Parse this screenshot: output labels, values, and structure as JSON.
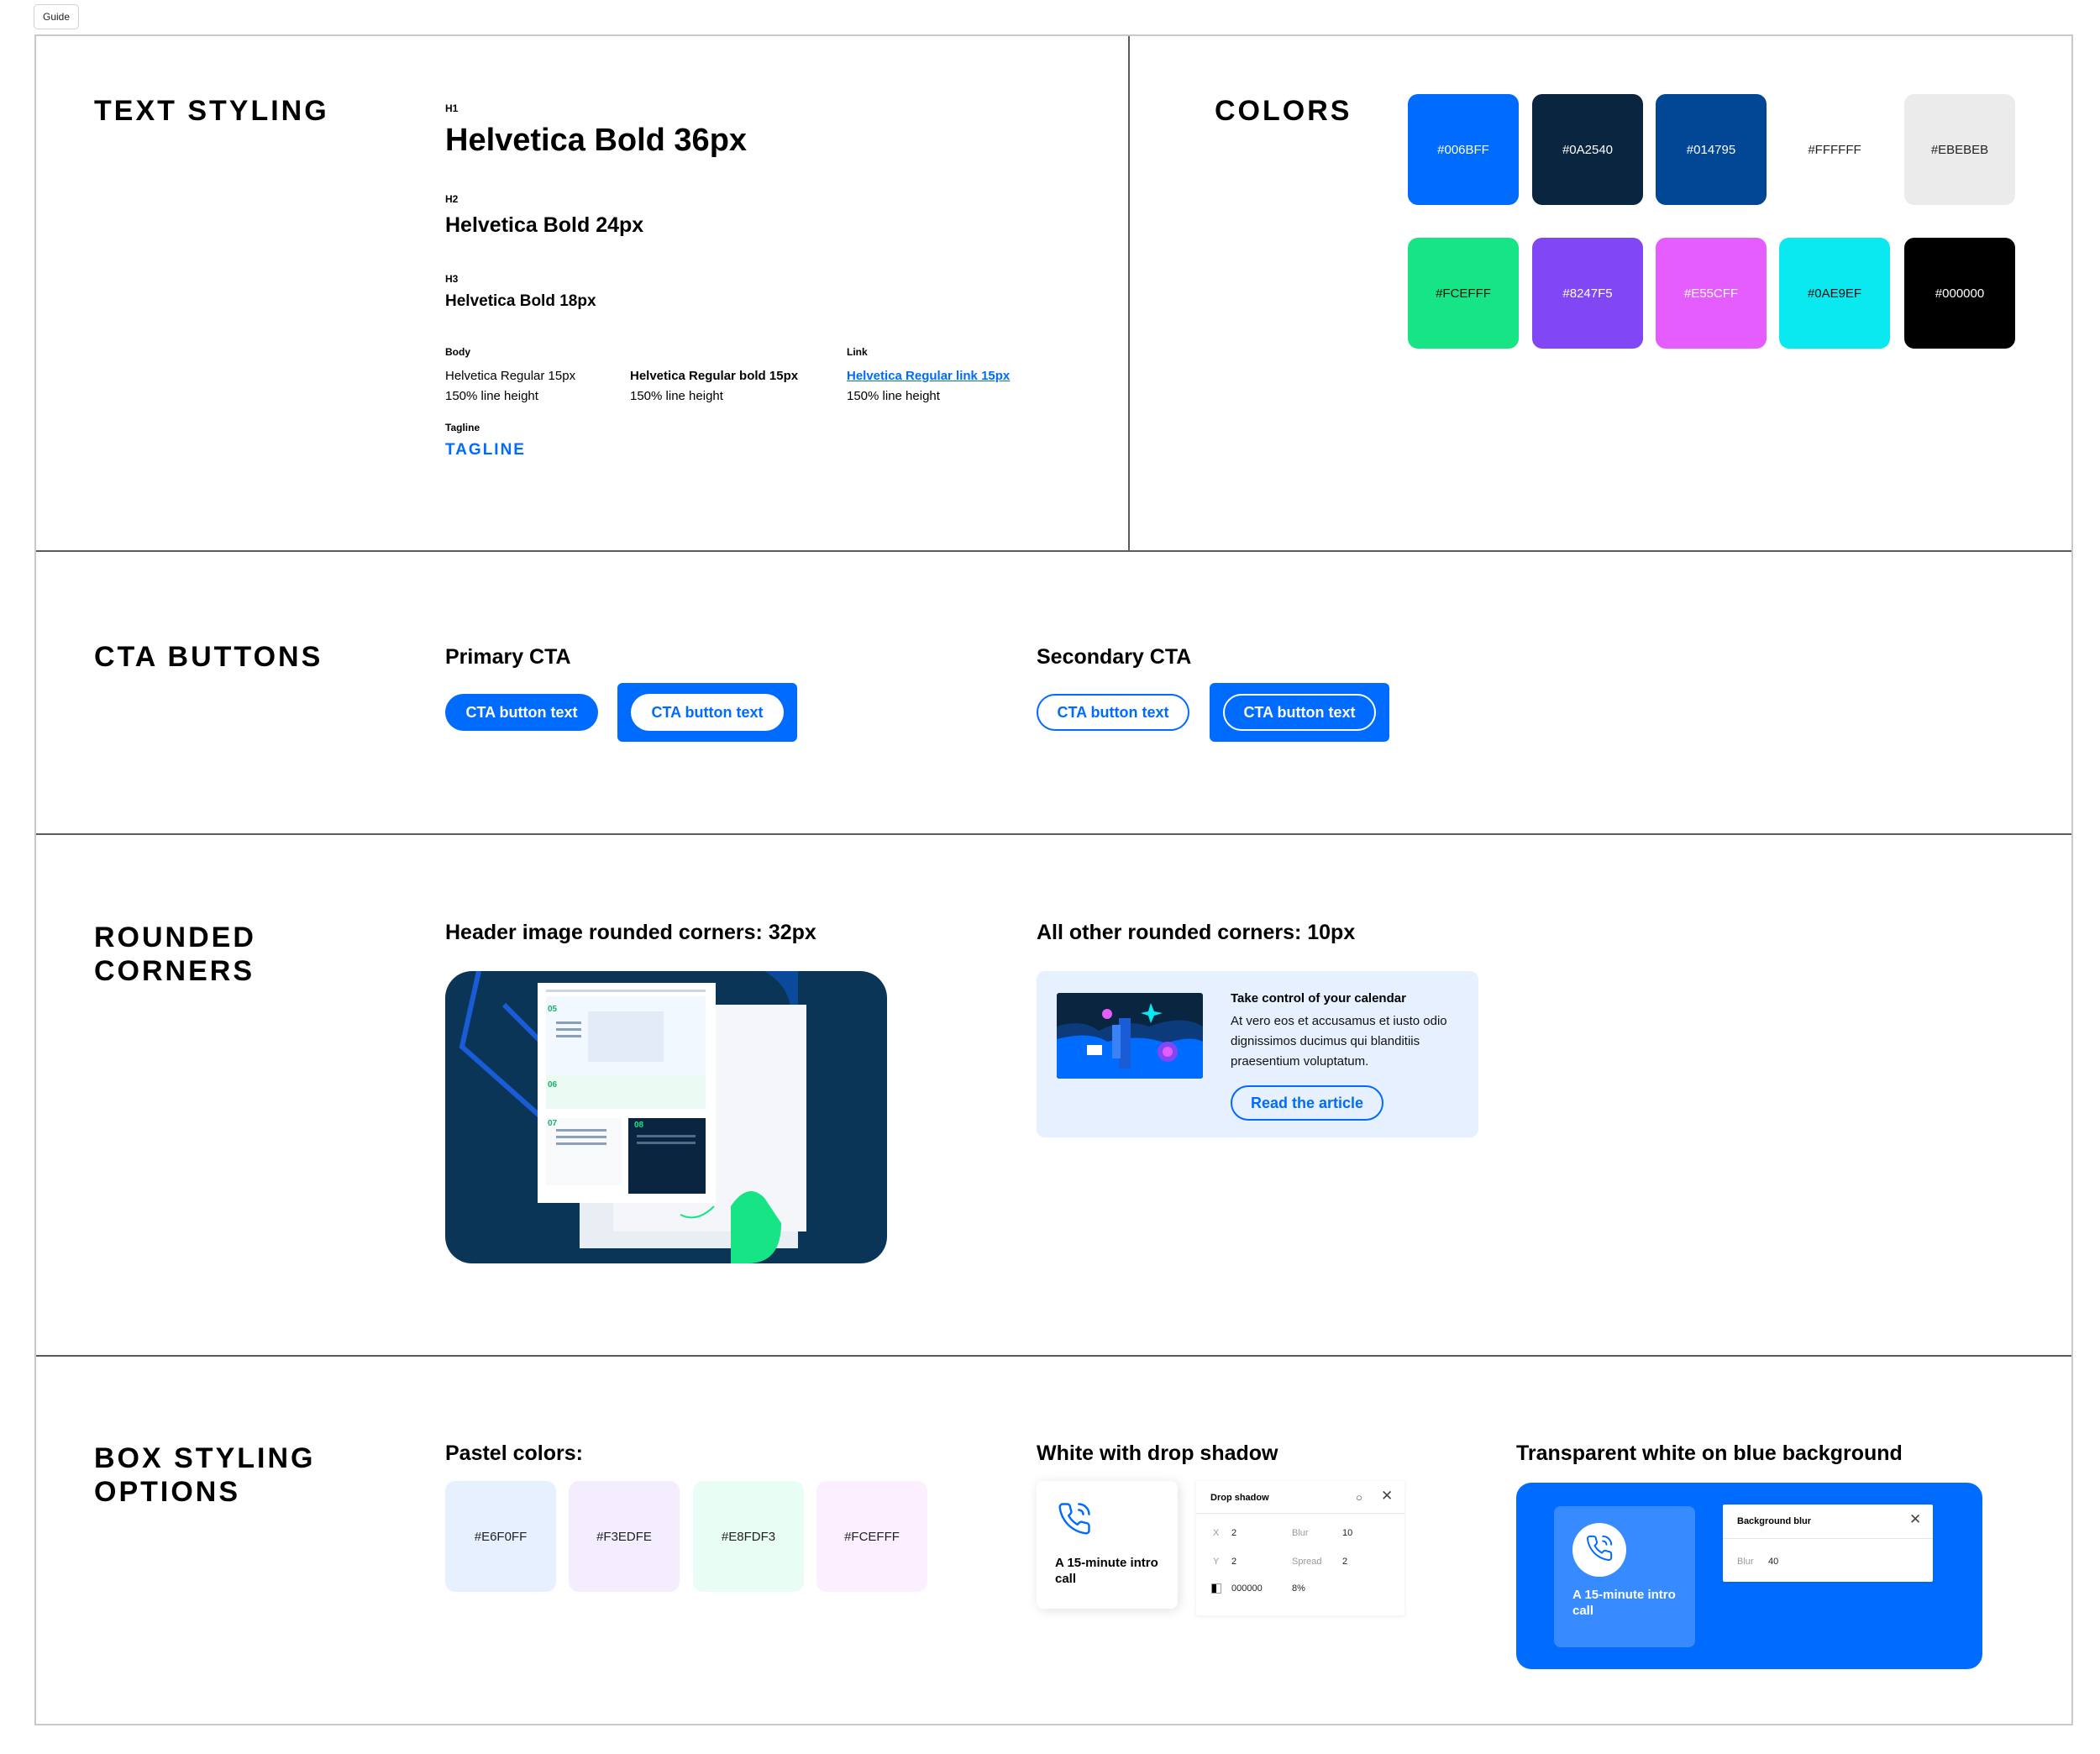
{
  "guide_tab": "Guide",
  "text_styling": {
    "title": "TEXT STYLING",
    "h1_label": "H1",
    "h1_sample": "Helvetica Bold 36px",
    "h2_label": "H2",
    "h2_sample": "Helvetica Bold 24px",
    "h3_label": "H3",
    "h3_sample": "Helvetica Bold 18px",
    "body_label": "Body",
    "body_regular": "Helvetica Regular 15px",
    "body_regular_lh": "150% line height",
    "body_bold": "Helvetica Regular bold 15px",
    "body_bold_lh": "150% line height",
    "link_label": "Link",
    "link_sample": "Helvetica Regular link 15px",
    "link_lh": "150% line height",
    "tagline_label": "Tagline",
    "tagline_sample": "TAGLINE"
  },
  "colors": {
    "title": "COLORS",
    "swatches": [
      {
        "label": "#006BFF",
        "bg": "#006BFF",
        "fg": "#ffffff"
      },
      {
        "label": "#0A2540",
        "bg": "#0A2540",
        "fg": "#ffffff"
      },
      {
        "label": "#014795",
        "bg": "#014795",
        "fg": "#ffffff"
      },
      {
        "label": "#FFFFFF",
        "bg": "#FFFFFF",
        "fg": "#222222"
      },
      {
        "label": "#EBEBEB",
        "bg": "#EBEBEB",
        "fg": "#222222"
      },
      {
        "label": "#FCEFFF",
        "bg": "#17E585",
        "fg": "#111111"
      },
      {
        "label": "#8247F5",
        "bg": "#8247F5",
        "fg": "#ffffff"
      },
      {
        "label": "#E55CFF",
        "bg": "#E55CFF",
        "fg": "#ffffff"
      },
      {
        "label": "#0AE9EF",
        "bg": "#0AE9EF",
        "fg": "#111111"
      },
      {
        "label": "#000000",
        "bg": "#000000",
        "fg": "#ffffff"
      }
    ]
  },
  "cta": {
    "title": "CTA BUTTONS",
    "primary_title": "Primary CTA",
    "secondary_title": "Secondary CTA",
    "button_text": "CTA button text"
  },
  "rounded": {
    "title": "ROUNDED CORNERS",
    "header_title": "Header image rounded corners: 32px",
    "other_title": "All other rounded corners: 10px",
    "article_title": "Take control of your calendar",
    "article_text": "At vero eos et accusamus et iusto odio dignissimos ducimus qui blanditiis praesentium voluptatum.",
    "article_button": "Read the article",
    "doc_numbers": [
      "05",
      "06",
      "07",
      "08"
    ]
  },
  "box": {
    "title": "BOX STYLING OPTIONS",
    "pastel_title": "Pastel colors:",
    "pastels": [
      {
        "label": "#E6F0FF",
        "bg": "#E6F0FF"
      },
      {
        "label": "#F3EDFE",
        "bg": "#F3EDFE"
      },
      {
        "label": "#E8FDF3",
        "bg": "#E8FDF3"
      },
      {
        "label": "#FCEFFF",
        "bg": "#FCEFFF"
      }
    ],
    "shadow_title": "White with drop shadow",
    "card_caption": "A 15-minute intro call",
    "drop_shadow": {
      "title": "Drop shadow",
      "x_label": "X",
      "x_value": "2",
      "blur_label": "Blur",
      "blur_value": "10",
      "y_label": "Y",
      "y_value": "2",
      "spread_label": "Spread",
      "spread_value": "2",
      "color_value": "000000",
      "opacity_value": "8%"
    },
    "transparent_title": "Transparent white on blue background",
    "background_blur": {
      "title": "Background blur",
      "blur_label": "Blur",
      "blur_value": "40"
    }
  }
}
